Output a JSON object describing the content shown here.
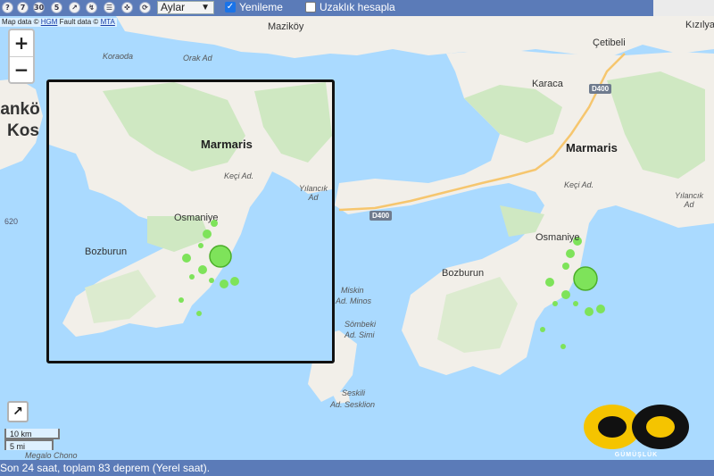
{
  "toolbar": {
    "icons": [
      {
        "name": "help-icon",
        "glyph": "?"
      },
      {
        "name": "seven-day-icon",
        "glyph": "7"
      },
      {
        "name": "thirty-day-icon",
        "glyph": "30"
      },
      {
        "name": "magnitude-icon",
        "glyph": "5"
      },
      {
        "name": "plate-icon",
        "glyph": "↗"
      },
      {
        "name": "fault-icon",
        "glyph": "↯"
      },
      {
        "name": "list-icon",
        "glyph": "☰"
      },
      {
        "name": "crosshair-icon",
        "glyph": "✜"
      },
      {
        "name": "refresh-icon",
        "glyph": "⟳"
      },
      {
        "name": "info-icon",
        "glyph": "?"
      }
    ],
    "period_select": "Aylar",
    "refresh_checkbox_label": "Yenileme",
    "refresh_checked": true,
    "distance_checkbox_label": "Uzaklık hesapla",
    "distance_checked": false
  },
  "attribution": {
    "prefix": "Map data ©",
    "hgm": "HGM",
    "fault_prefix": "Fault data ©",
    "mta": "MTA"
  },
  "zoom": {
    "plus": "+",
    "minus": "−"
  },
  "labels": {
    "kos_partial": "tankö",
    "kos": "Kos",
    "depth_620": "620",
    "marmaris": "Marmaris",
    "karaca": "Karaca",
    "koraoda": "Koraoda",
    "orak_ad": "Orak Ad",
    "maziköy": "Maziköy",
    "cetibeli": "Çetibeli",
    "kizilyaka": "Kızılyaka",
    "keci_ad": "Keçi Ad.",
    "yilancik_ad": "Yılancık\nAd",
    "osmaniye": "Osmaniye",
    "bozburun": "Bozburun",
    "miskin": "Miskin",
    "ad_minos": "Ad. Minos",
    "sombeki": "Sömbeki",
    "ad_simi": "Ad. Simi",
    "seskili": "Seskili",
    "ad_sesklion": "Ad. Sesklion",
    "megalo_chono": "Megalo Chono",
    "road": "D400",
    "inset_marmaris": "Marmaris",
    "inset_keci": "Keçi Ad.",
    "inset_yilancik": "Yılancık\nAd",
    "inset_osmaniye": "Osmaniye",
    "inset_bozburun": "Bozburun"
  },
  "scale": {
    "km": "10 km",
    "mi": "5 mi"
  },
  "logo": {
    "text": "GÜMÜŞLÜK",
    "accent": "#f5c400"
  },
  "status_text": "Son 24 saat, toplam 83 deprem (Yerel saat).",
  "colors": {
    "sea": "#aadaff",
    "land": "#f2efe9",
    "green_land": "#cfe8c2",
    "quake": "#7ee35a",
    "quake_stroke": "#4caf2a",
    "toolbar": "#5b7bb8"
  }
}
